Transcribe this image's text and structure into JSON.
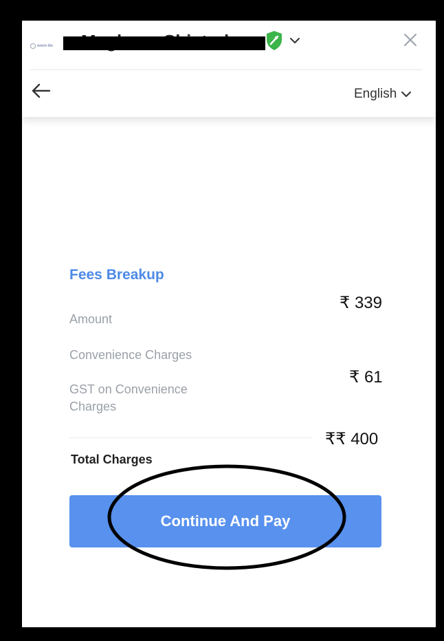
{
  "header": {
    "logo_text": "करदाता सेवा",
    "user_name": "Meghana Shivtarkar",
    "language": "English"
  },
  "icons": {
    "shield": "verified-shield-icon",
    "user_menu": "chevron-down-icon",
    "close": "close-icon",
    "back": "back-arrow-icon",
    "language_menu": "chevron-down-icon"
  },
  "fees": {
    "title": "Fees Breakup",
    "amount_label": "Amount",
    "amount_value": "₹ 339",
    "convenience_label": "Convenience Charges",
    "gst_label": "GST on Convenience Charges",
    "gst_value": "₹ 61",
    "total_label": "Total Charges",
    "total_value": "₹₹ 400"
  },
  "actions": {
    "pay_label": "Continue And Pay"
  },
  "colors": {
    "accent": "#5891ee",
    "title_blue": "#4d8ae6",
    "shield_green": "#3cb54a",
    "annotation": "#000000"
  }
}
